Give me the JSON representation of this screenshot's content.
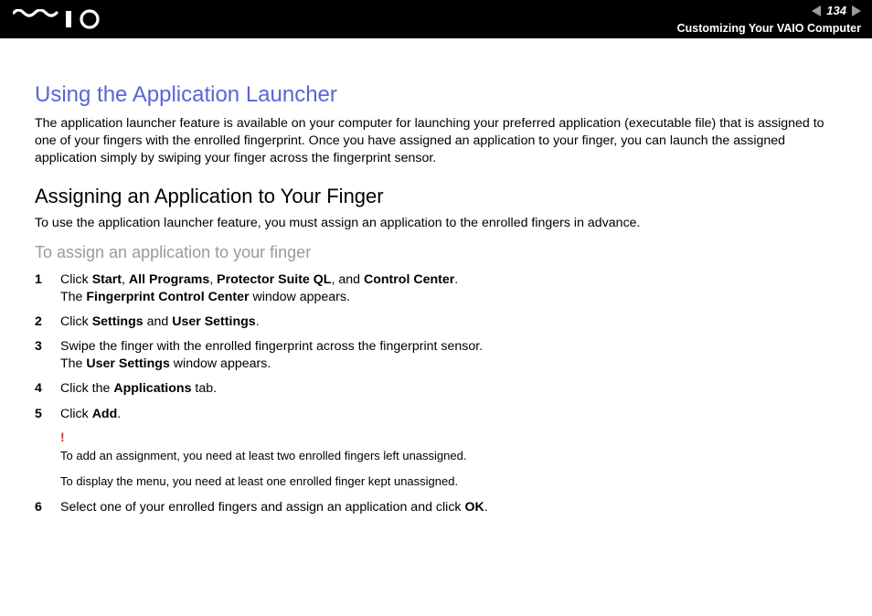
{
  "header": {
    "logo_text": "VAIO",
    "page_number": "134",
    "breadcrumb": "Customizing Your VAIO Computer"
  },
  "section_title": "Using the Application Launcher",
  "section_body": "The application launcher feature is available on your computer for launching your preferred application (executable file) that is assigned to one of your fingers with the enrolled fingerprint. Once you have assigned an application to your finger, you can launch the assigned application simply by swiping your finger across the fingerprint sensor.",
  "sub_title": "Assigning an Application to Your Finger",
  "sub_lead": "To use the application launcher feature, you must assign an application to the enrolled fingers in advance.",
  "task_title": "To assign an application to your finger",
  "steps": {
    "s1": {
      "pre": "Click ",
      "b1": "Start",
      "sep1": ", ",
      "b2": "All Programs",
      "sep2": ", ",
      "b3": "Protector Suite QL",
      "sep3": ", and ",
      "b4": "Control Center",
      "post": ".",
      "line2a": "The ",
      "line2b": "Fingerprint Control Center",
      "line2c": " window appears."
    },
    "s2": {
      "pre": "Click ",
      "b1": "Settings",
      "sep1": " and ",
      "b2": "User Settings",
      "post": "."
    },
    "s3": {
      "line1": "Swipe the finger with the enrolled fingerprint across the fingerprint sensor.",
      "line2a": "The ",
      "line2b": "User Settings",
      "line2c": " window appears."
    },
    "s4": {
      "pre": "Click the ",
      "b1": "Applications",
      "post": " tab."
    },
    "s5": {
      "pre": "Click ",
      "b1": "Add",
      "post": "."
    },
    "s6": {
      "pre": "Select one of your enrolled fingers and assign an application and click ",
      "b1": "OK",
      "post": "."
    }
  },
  "note": {
    "bang": "!",
    "p1": "To add an assignment, you need at least two enrolled fingers left unassigned.",
    "p2": "To display the menu, you need at least one enrolled finger kept unassigned."
  }
}
